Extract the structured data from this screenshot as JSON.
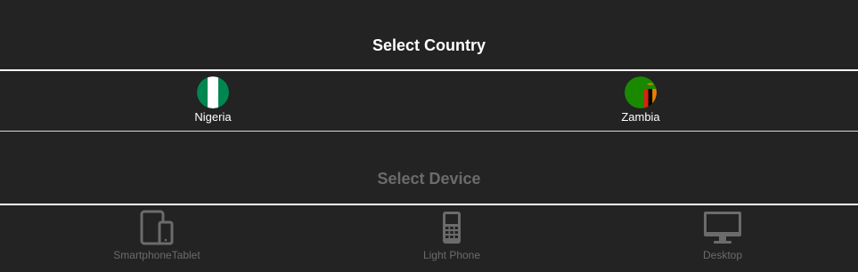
{
  "country_section": {
    "title": "Select Country",
    "countries": [
      {
        "label": "Nigeria",
        "flag_icon": "nigeria-flag-icon",
        "colors": [
          "#008751",
          "#ffffff",
          "#008751"
        ]
      },
      {
        "label": "Zambia",
        "flag_icon": "zambia-flag-icon",
        "colors": [
          "#198a00",
          "#de2010",
          "#000000",
          "#ef7d00"
        ]
      }
    ]
  },
  "device_section": {
    "title": "Select Device",
    "devices": [
      {
        "label": "SmartphoneTablet",
        "icon": "smartphone-tablet-icon"
      },
      {
        "label": "Light Phone",
        "icon": "feature-phone-icon"
      },
      {
        "label": "Desktop",
        "icon": "desktop-monitor-icon"
      }
    ]
  },
  "colors": {
    "background": "#232323",
    "active_text": "#ffffff",
    "disabled_text": "#6b6b6b",
    "divider": "#ffffff"
  }
}
